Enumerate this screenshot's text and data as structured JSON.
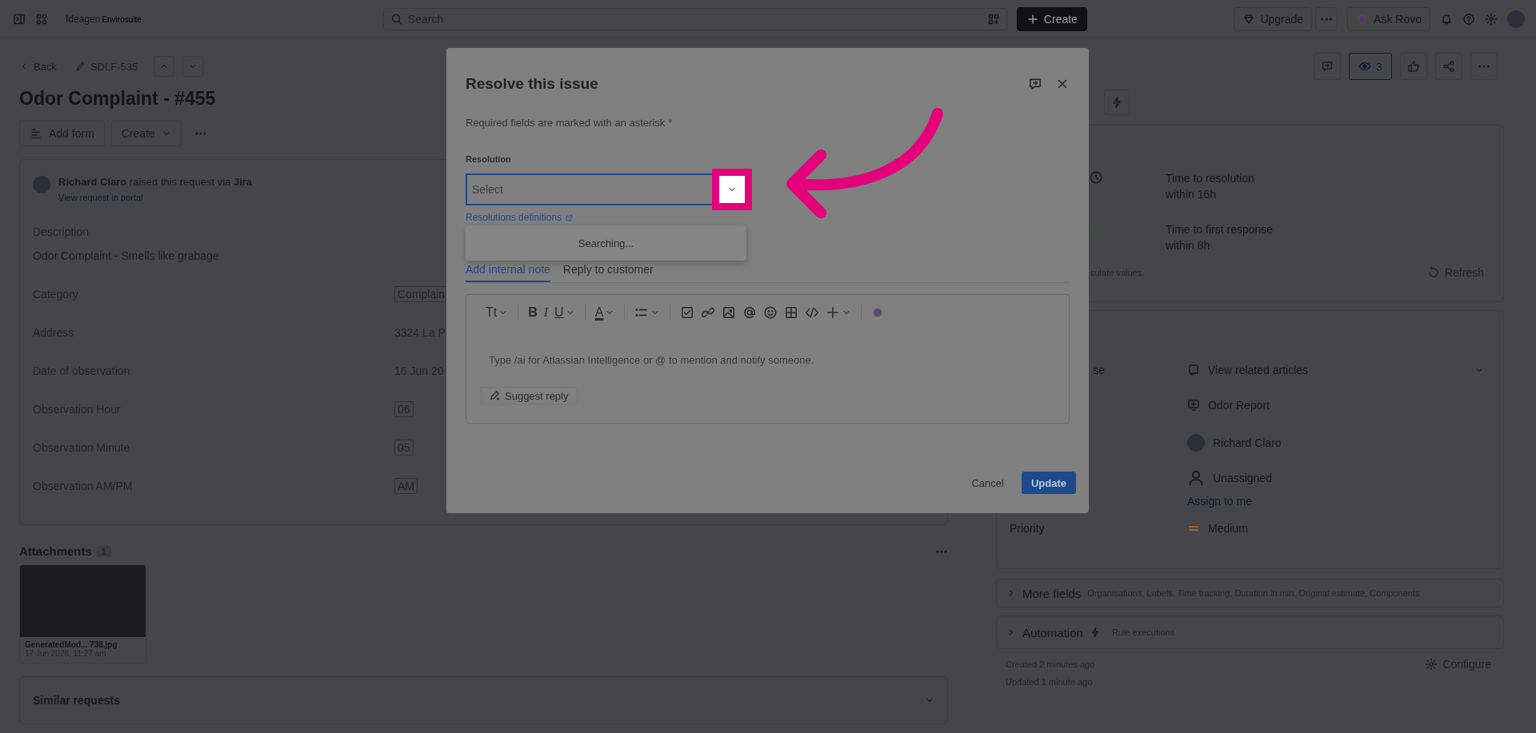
{
  "top_bar": {
    "logo": "Ideagen",
    "logo_sub": "Envirosuite",
    "search": {
      "placeholder": "Search"
    },
    "create": "Create",
    "upgrade": "Upgrade",
    "ask_rovo": "Ask Rovo"
  },
  "issue": {
    "back": "Back",
    "key": "SDLF-535",
    "title": "Odor Complaint - #455",
    "add_form": "Add form",
    "create": "Create",
    "reporter": "**Richard Claro** raised this request via **Jira**",
    "portal_link": "View request in portal",
    "description_label": "Description",
    "description": "Odor Complaint - Smells like grabage",
    "fields": [
      {
        "label": "Category",
        "value": "Complain",
        "kind": "tag"
      },
      {
        "label": "Address",
        "value": "3324 La P",
        "kind": "text"
      },
      {
        "label": "Date of observation",
        "value": "16 Jun 20",
        "kind": "text"
      },
      {
        "label": "Observation Hour",
        "value": "06",
        "kind": "tag"
      },
      {
        "label": "Observation Minute",
        "value": "05",
        "kind": "tag"
      },
      {
        "label": "Observation AM/PM",
        "value": "AM",
        "kind": "tag"
      }
    ]
  },
  "attachments": {
    "title": "Attachments",
    "count": "1",
    "files": [
      {
        "name": "GeneratedMod... 738.jpg",
        "date": "17 Jun 2026, 11:27 am"
      }
    ]
  },
  "similar_requests": {
    "title": "Similar requests"
  },
  "side": {
    "watchers": "3",
    "sla": [
      {
        "name": "Time to resolution",
        "target": "within 16h",
        "kind": "clock"
      },
      {
        "name": "Time to first response",
        "target": "within 8h",
        "kind": "check"
      }
    ],
    "sla_note": "culate values.",
    "refresh": "Refresh",
    "details": [
      {
        "label": "se",
        "value": "View related articles",
        "kind": "articles"
      },
      {
        "value": "Odor Report",
        "kind": "request_type"
      },
      {
        "value": "Richard Claro",
        "kind": "person"
      },
      {
        "value": "Unassigned",
        "kind": "unassigned",
        "link": "Assign to me"
      },
      {
        "label": "Priority",
        "value": "Medium",
        "kind": "priority"
      }
    ],
    "more_fields": {
      "title": "More fields",
      "summary": "Organisations, Labels, Time tracking, Duration in min, Original estimate, Components"
    },
    "automation": {
      "title": "Automation",
      "summary": "Rule executions"
    },
    "created": "Created 2 minutes ago",
    "updated": "Updated 1 minute ago",
    "configure": "Configure"
  },
  "dialog": {
    "title": "Resolve this issue",
    "required_note": "Required fields are marked with an asterisk",
    "required_mark": "*",
    "field_label": "Resolution",
    "field": {
      "placeholder": "Select"
    },
    "link": "Resolutions definitions",
    "dropdown": "Searching...",
    "tabs": [
      {
        "label": "Add internal note",
        "selected": true
      },
      {
        "label": "Reply to customer",
        "selected": false
      }
    ],
    "toolbar_glyphs": [
      "Tt",
      "B",
      "I",
      "U",
      "A"
    ],
    "editor": {
      "placeholder": "Type /ai for Atlassian Intelligence or @ to mention and notify someone.",
      "suggest": "Suggest reply"
    },
    "cancel": "Cancel",
    "update": "Update"
  }
}
